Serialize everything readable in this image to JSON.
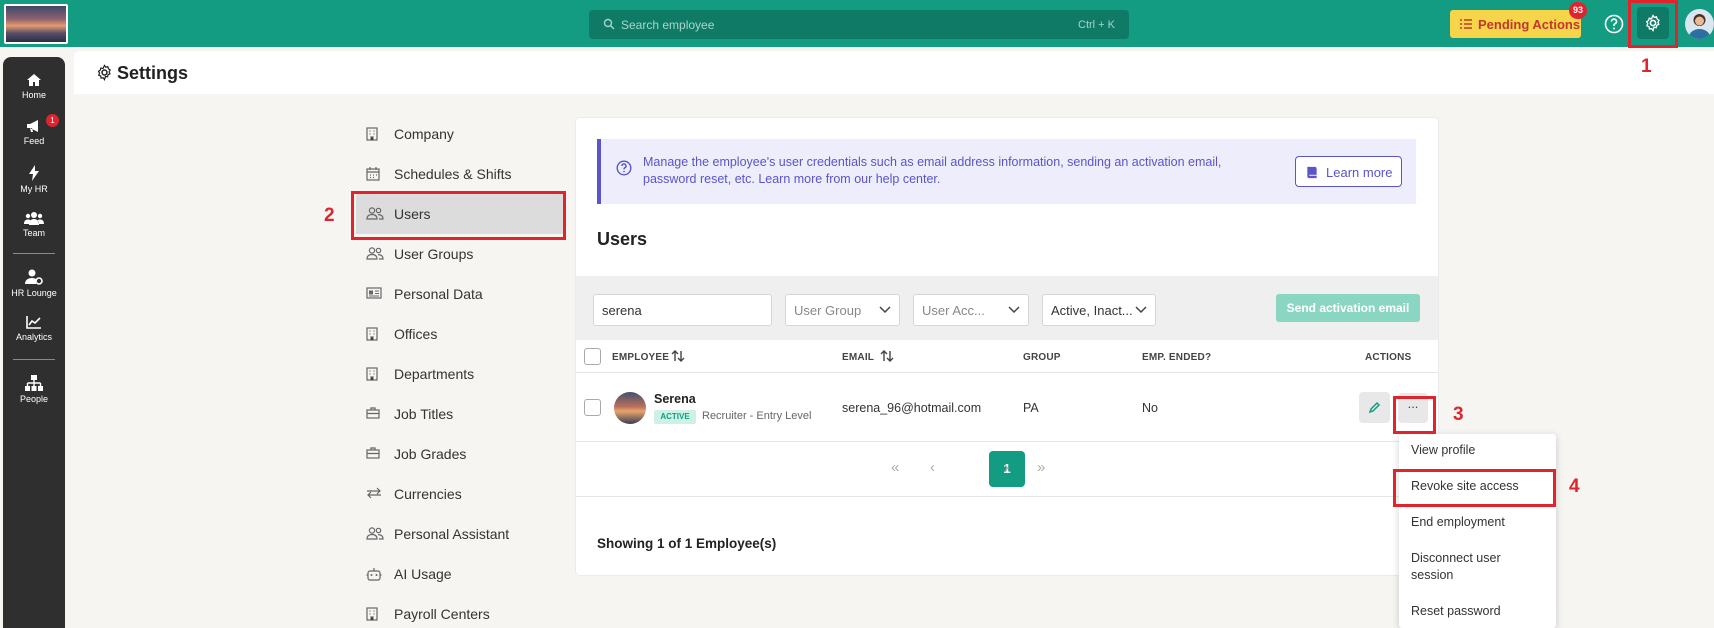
{
  "topbar": {
    "search_placeholder": "Search employee",
    "search_shortcut": "Ctrl + K",
    "pending_label": "Pending Actions",
    "pending_count": "93"
  },
  "sidenav": {
    "items": [
      {
        "label": "Home",
        "icon": "home-icon"
      },
      {
        "label": "Feed",
        "icon": "megaphone-icon",
        "badge": "1"
      },
      {
        "label": "My HR",
        "icon": "bolt-icon"
      },
      {
        "label": "Team",
        "icon": "team-icon"
      },
      {
        "label": "HR Lounge",
        "icon": "user-gear-icon"
      },
      {
        "label": "Analytics",
        "icon": "chart-icon"
      },
      {
        "label": "People",
        "icon": "org-chart-icon"
      }
    ]
  },
  "page": {
    "title": "Settings"
  },
  "settings_menu": [
    {
      "label": "Company",
      "icon": "building-icon"
    },
    {
      "label": "Schedules & Shifts",
      "icon": "calendar-icon"
    },
    {
      "label": "Users",
      "icon": "users-icon",
      "active": true
    },
    {
      "label": "User Groups",
      "icon": "users-icon"
    },
    {
      "label": "Personal Data",
      "icon": "id-card-icon"
    },
    {
      "label": "Offices",
      "icon": "building-icon"
    },
    {
      "label": "Departments",
      "icon": "building-icon"
    },
    {
      "label": "Job Titles",
      "icon": "briefcase-icon"
    },
    {
      "label": "Job Grades",
      "icon": "briefcase-icon"
    },
    {
      "label": "Currencies",
      "icon": "exchange-icon"
    },
    {
      "label": "Personal Assistant",
      "icon": "users-icon"
    },
    {
      "label": "AI Usage",
      "icon": "robot-icon"
    },
    {
      "label": "Payroll Centers",
      "icon": "building-icon"
    }
  ],
  "info": {
    "text": "Manage the employee's user credentials such as email address information, sending an activation email, password reset, etc. Learn more from our help center.",
    "learn_more": "Learn more"
  },
  "users": {
    "title": "Users",
    "filters": {
      "search_value": "serena",
      "user_group": "User Group",
      "user_access": "User Acc...",
      "status": "Active, Inact..."
    },
    "send_activation": "Send activation email",
    "columns": {
      "employee": "EMPLOYEE",
      "email": "EMAIL",
      "group": "GROUP",
      "ended": "EMP. ENDED?",
      "actions": "ACTIONS"
    },
    "rows": [
      {
        "name": "Serena",
        "status": "ACTIVE",
        "role": "Recruiter - Entry Level",
        "email": "serena_96@hotmail.com",
        "group": "PA",
        "ended": "No"
      }
    ],
    "pagination": {
      "first": "«",
      "prev": "‹",
      "current": "1",
      "next": "›",
      "last": "»"
    },
    "showing": "Showing 1 of 1 Employee(s)",
    "more_label": "..."
  },
  "dropdown": [
    "View profile",
    "Revoke site access",
    "End employment",
    "Disconnect user session",
    "Reset password"
  ],
  "annotations": [
    "1",
    "2",
    "3",
    "4"
  ],
  "colors": {
    "brand": "#139c81",
    "accent": "#5a55c9",
    "highlight": "#e0242e",
    "pending": "#f6d54b"
  }
}
